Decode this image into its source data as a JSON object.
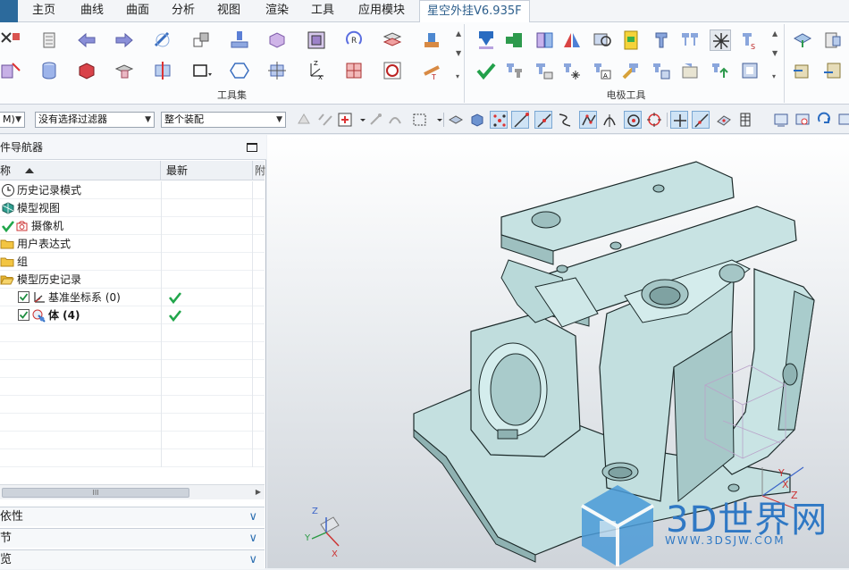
{
  "menubar": {
    "items": [
      "主页",
      "曲线",
      "曲面",
      "分析",
      "视图",
      "渲染",
      "工具",
      "应用模块",
      "星空外挂V6.935F"
    ],
    "active_index": 8,
    "accent_color": "#2c6a9c"
  },
  "ribbon": {
    "groups": [
      {
        "label": "工具集"
      },
      {
        "label": "电极工具"
      }
    ]
  },
  "cmdbar": {
    "mode_value": "M)",
    "filter_value": "没有选择过滤器",
    "assembly_value": "整个装配"
  },
  "navigator": {
    "title": "件导航器",
    "columns": {
      "name": "称",
      "latest": "最新",
      "third": "附"
    },
    "rows": [
      {
        "label": "历史记录模式",
        "icon": "clock-icon",
        "latest": false
      },
      {
        "label": "模型视图",
        "icon": "model-view-icon",
        "latest": false
      },
      {
        "label": "摄像机",
        "icon": "camera-icon",
        "latest": false
      },
      {
        "label": "用户表达式",
        "icon": "folder-icon",
        "latest": false
      },
      {
        "label": "组",
        "icon": "folder-icon",
        "latest": false
      },
      {
        "label": "模型历史记录",
        "icon": "folder-open-icon",
        "latest": false
      },
      {
        "label": "基准坐标系 (0)",
        "icon": "datum-csys-icon",
        "latest": true,
        "checked": true
      },
      {
        "label": "体 (4)",
        "icon": "body-icon",
        "latest": true,
        "checked": true,
        "bold": true
      }
    ],
    "sections": [
      "依性",
      "节",
      "览"
    ],
    "scroll_glyph": "III"
  },
  "graphics": {
    "watermark": "3D世界网",
    "watermark_url": "WWW.3DSJW.COM",
    "triad_labels": {
      "x": "X",
      "y": "Y",
      "z": "Z"
    },
    "view_triad": {
      "x": "X",
      "y": "Y",
      "z": "Z"
    },
    "model_color": "#c7e3e3"
  }
}
